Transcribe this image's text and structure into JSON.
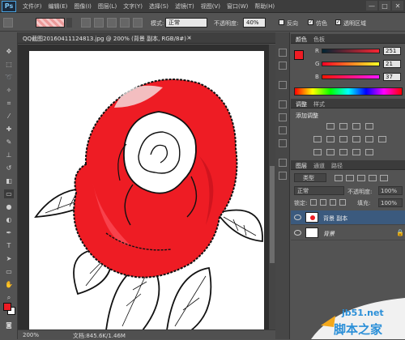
{
  "menubar": {
    "logo": "Ps",
    "items": [
      "文件(F)",
      "编辑(E)",
      "图像(I)",
      "图层(L)",
      "文字(Y)",
      "选择(S)",
      "滤镜(T)",
      "视图(V)",
      "窗口(W)",
      "帮助(H)"
    ],
    "controls": [
      "—",
      "□",
      "✕"
    ]
  },
  "options": {
    "mode_label": "模式:",
    "mode_value": "正常",
    "opacity_label": "不透明度:",
    "opacity_value": "40%",
    "reverse_label": "反向",
    "dither_label": "仿色",
    "transparency_label": "透明区域"
  },
  "document": {
    "title": "QQ截图20160411124813.jpg @ 200% (背景 副本, RGB/8#) *",
    "close": "×",
    "zoom": "200%",
    "doc_size": "文档:845.6K/1.46M"
  },
  "color_panel": {
    "tabs": [
      "颜色",
      "色板"
    ],
    "channels": [
      {
        "label": "R",
        "value": "251"
      },
      {
        "label": "G",
        "value": "21"
      },
      {
        "label": "B",
        "value": "37"
      }
    ],
    "foreground": "#fb1525",
    "background": "#ffffff"
  },
  "adjust_panel": {
    "tabs": [
      "调整",
      "样式"
    ],
    "title": "添加调整"
  },
  "layers_panel": {
    "tabs": [
      "图层",
      "通道",
      "路径"
    ],
    "filter_label": "类型",
    "blend_mode": "正常",
    "opacity_label": "不透明度:",
    "opacity_value": "100%",
    "lock_label": "锁定:",
    "fill_label": "填充:",
    "fill_value": "100%",
    "layers": [
      {
        "name": "背景 副本",
        "selected": true
      },
      {
        "name": "背景",
        "selected": false
      }
    ]
  },
  "watermark": {
    "url": "jb51.net",
    "site": "脚本之家"
  },
  "colors": {
    "accent_red": "#ee1c24",
    "panel_bg": "#535353",
    "selection_blue": "#3b5a7e"
  }
}
